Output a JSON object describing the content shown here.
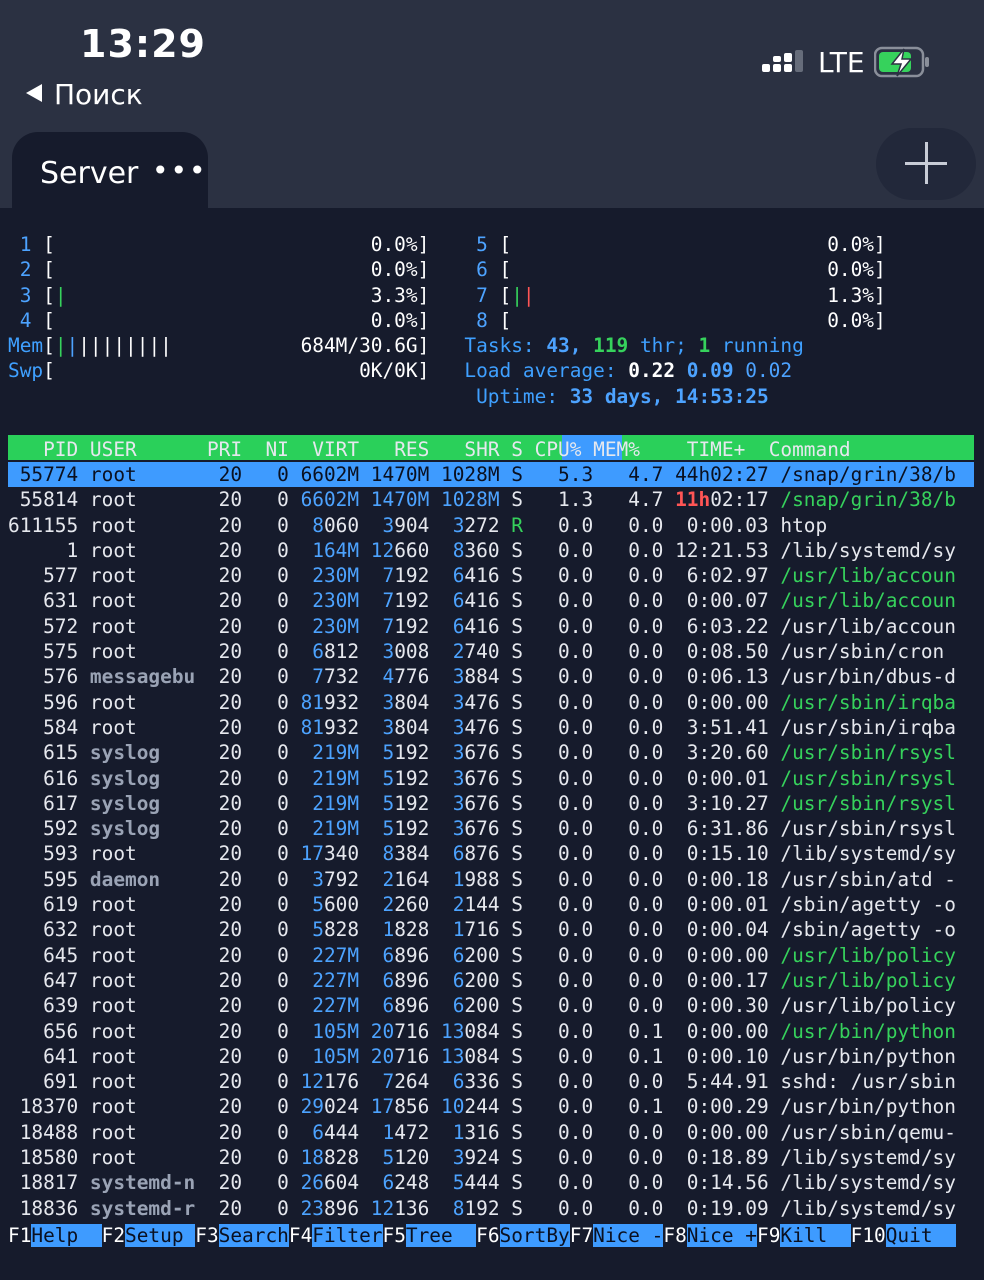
{
  "status_bar": {
    "time": "13:29",
    "back_label": "Поиск",
    "network": "LTE"
  },
  "tabs": [
    {
      "label": "Server"
    }
  ],
  "meters": {
    "cpus": [
      {
        "id": "1",
        "bar": "",
        "value": "0.0%"
      },
      {
        "id": "2",
        "bar": "",
        "value": "0.0%"
      },
      {
        "id": "3",
        "bar": "|",
        "value": "3.3%"
      },
      {
        "id": "4",
        "bar": "",
        "value": "0.0%"
      },
      {
        "id": "5",
        "bar": "",
        "value": "0.0%"
      },
      {
        "id": "6",
        "bar": "",
        "value": "0.0%"
      },
      {
        "id": "7",
        "bar": "||",
        "value": "1.3%"
      },
      {
        "id": "8",
        "bar": "",
        "value": "0.0%"
      }
    ],
    "mem_label": "Mem",
    "mem_bar": "||||||||||",
    "mem_value": "684M/30.6G",
    "swp_label": "Swp",
    "swp_value": "0K/0K",
    "tasks_label": "Tasks:",
    "tasks": "43,",
    "threads": "119",
    "thr_label": "thr;",
    "running": "1",
    "running_label": "running",
    "load_label": "Load average:",
    "load1": "0.22",
    "load5": "0.09",
    "load15": "0.02",
    "uptime_label": "Uptime:",
    "uptime": "33 days, 14:53:25"
  },
  "columns": [
    "PID",
    "USER",
    "PRI",
    "NI",
    "VIRT",
    "RES",
    "SHR",
    "S",
    "CPU%",
    "MEM%",
    "TIME+",
    "Command"
  ],
  "processes": [
    {
      "pid": "55774",
      "user": "root",
      "pri": "20",
      "ni": "0",
      "virt": "6602M",
      "res": "1470M",
      "shr": "1028M",
      "s": "S",
      "cpu": "5.3",
      "mem": "4.7",
      "time": "44h02:27",
      "cmd": "/snap/grin/38/b"
    },
    {
      "pid": "55814",
      "user": "root",
      "pri": "20",
      "ni": "0",
      "virt": "6602M",
      "res": "1470M",
      "shr": "1028M",
      "s": "S",
      "cpu": "1.3",
      "mem": "4.7",
      "time": "11h02:17",
      "cmd": "/snap/grin/38/b"
    },
    {
      "pid": "611155",
      "user": "root",
      "pri": "20",
      "ni": "0",
      "virt": "8060",
      "res": "3904",
      "shr": "3272",
      "s": "R",
      "cpu": "0.0",
      "mem": "0.0",
      "time": "0:00.03",
      "cmd": "htop"
    },
    {
      "pid": "1",
      "user": "root",
      "pri": "20",
      "ni": "0",
      "virt": "164M",
      "res": "12660",
      "shr": "8360",
      "s": "S",
      "cpu": "0.0",
      "mem": "0.0",
      "time": "12:21.53",
      "cmd": "/lib/systemd/sy"
    },
    {
      "pid": "577",
      "user": "root",
      "pri": "20",
      "ni": "0",
      "virt": "230M",
      "res": "7192",
      "shr": "6416",
      "s": "S",
      "cpu": "0.0",
      "mem": "0.0",
      "time": "6:02.97",
      "cmd": "/usr/lib/accoun"
    },
    {
      "pid": "631",
      "user": "root",
      "pri": "20",
      "ni": "0",
      "virt": "230M",
      "res": "7192",
      "shr": "6416",
      "s": "S",
      "cpu": "0.0",
      "mem": "0.0",
      "time": "0:00.07",
      "cmd": "/usr/lib/accoun"
    },
    {
      "pid": "572",
      "user": "root",
      "pri": "20",
      "ni": "0",
      "virt": "230M",
      "res": "7192",
      "shr": "6416",
      "s": "S",
      "cpu": "0.0",
      "mem": "0.0",
      "time": "6:03.22",
      "cmd": "/usr/lib/accoun"
    },
    {
      "pid": "575",
      "user": "root",
      "pri": "20",
      "ni": "0",
      "virt": "6812",
      "res": "3008",
      "shr": "2740",
      "s": "S",
      "cpu": "0.0",
      "mem": "0.0",
      "time": "0:08.50",
      "cmd": "/usr/sbin/cron"
    },
    {
      "pid": "576",
      "user": "messagebu",
      "pri": "20",
      "ni": "0",
      "virt": "7732",
      "res": "4776",
      "shr": "3884",
      "s": "S",
      "cpu": "0.0",
      "mem": "0.0",
      "time": "0:06.13",
      "cmd": "/usr/bin/dbus-d"
    },
    {
      "pid": "596",
      "user": "root",
      "pri": "20",
      "ni": "0",
      "virt": "81932",
      "res": "3804",
      "shr": "3476",
      "s": "S",
      "cpu": "0.0",
      "mem": "0.0",
      "time": "0:00.00",
      "cmd": "/usr/sbin/irqba"
    },
    {
      "pid": "584",
      "user": "root",
      "pri": "20",
      "ni": "0",
      "virt": "81932",
      "res": "3804",
      "shr": "3476",
      "s": "S",
      "cpu": "0.0",
      "mem": "0.0",
      "time": "3:51.41",
      "cmd": "/usr/sbin/irqba"
    },
    {
      "pid": "615",
      "user": "syslog",
      "pri": "20",
      "ni": "0",
      "virt": "219M",
      "res": "5192",
      "shr": "3676",
      "s": "S",
      "cpu": "0.0",
      "mem": "0.0",
      "time": "3:20.60",
      "cmd": "/usr/sbin/rsysl"
    },
    {
      "pid": "616",
      "user": "syslog",
      "pri": "20",
      "ni": "0",
      "virt": "219M",
      "res": "5192",
      "shr": "3676",
      "s": "S",
      "cpu": "0.0",
      "mem": "0.0",
      "time": "0:00.01",
      "cmd": "/usr/sbin/rsysl"
    },
    {
      "pid": "617",
      "user": "syslog",
      "pri": "20",
      "ni": "0",
      "virt": "219M",
      "res": "5192",
      "shr": "3676",
      "s": "S",
      "cpu": "0.0",
      "mem": "0.0",
      "time": "3:10.27",
      "cmd": "/usr/sbin/rsysl"
    },
    {
      "pid": "592",
      "user": "syslog",
      "pri": "20",
      "ni": "0",
      "virt": "219M",
      "res": "5192",
      "shr": "3676",
      "s": "S",
      "cpu": "0.0",
      "mem": "0.0",
      "time": "6:31.86",
      "cmd": "/usr/sbin/rsysl"
    },
    {
      "pid": "593",
      "user": "root",
      "pri": "20",
      "ni": "0",
      "virt": "17340",
      "res": "8384",
      "shr": "6876",
      "s": "S",
      "cpu": "0.0",
      "mem": "0.0",
      "time": "0:15.10",
      "cmd": "/lib/systemd/sy"
    },
    {
      "pid": "595",
      "user": "daemon",
      "pri": "20",
      "ni": "0",
      "virt": "3792",
      "res": "2164",
      "shr": "1988",
      "s": "S",
      "cpu": "0.0",
      "mem": "0.0",
      "time": "0:00.18",
      "cmd": "/usr/sbin/atd -"
    },
    {
      "pid": "619",
      "user": "root",
      "pri": "20",
      "ni": "0",
      "virt": "5600",
      "res": "2260",
      "shr": "2144",
      "s": "S",
      "cpu": "0.0",
      "mem": "0.0",
      "time": "0:00.01",
      "cmd": "/sbin/agetty -o"
    },
    {
      "pid": "632",
      "user": "root",
      "pri": "20",
      "ni": "0",
      "virt": "5828",
      "res": "1828",
      "shr": "1716",
      "s": "S",
      "cpu": "0.0",
      "mem": "0.0",
      "time": "0:00.04",
      "cmd": "/sbin/agetty -o"
    },
    {
      "pid": "645",
      "user": "root",
      "pri": "20",
      "ni": "0",
      "virt": "227M",
      "res": "6896",
      "shr": "6200",
      "s": "S",
      "cpu": "0.0",
      "mem": "0.0",
      "time": "0:00.00",
      "cmd": "/usr/lib/policy"
    },
    {
      "pid": "647",
      "user": "root",
      "pri": "20",
      "ni": "0",
      "virt": "227M",
      "res": "6896",
      "shr": "6200",
      "s": "S",
      "cpu": "0.0",
      "mem": "0.0",
      "time": "0:00.17",
      "cmd": "/usr/lib/policy"
    },
    {
      "pid": "639",
      "user": "root",
      "pri": "20",
      "ni": "0",
      "virt": "227M",
      "res": "6896",
      "shr": "6200",
      "s": "S",
      "cpu": "0.0",
      "mem": "0.0",
      "time": "0:00.30",
      "cmd": "/usr/lib/policy"
    },
    {
      "pid": "656",
      "user": "root",
      "pri": "20",
      "ni": "0",
      "virt": "105M",
      "res": "20716",
      "shr": "13084",
      "s": "S",
      "cpu": "0.0",
      "mem": "0.1",
      "time": "0:00.00",
      "cmd": "/usr/bin/python"
    },
    {
      "pid": "641",
      "user": "root",
      "pri": "20",
      "ni": "0",
      "virt": "105M",
      "res": "20716",
      "shr": "13084",
      "s": "S",
      "cpu": "0.0",
      "mem": "0.1",
      "time": "0:00.10",
      "cmd": "/usr/bin/python"
    },
    {
      "pid": "691",
      "user": "root",
      "pri": "20",
      "ni": "0",
      "virt": "12176",
      "res": "7264",
      "shr": "6336",
      "s": "S",
      "cpu": "0.0",
      "mem": "0.0",
      "time": "5:44.91",
      "cmd": "sshd: /usr/sbin"
    },
    {
      "pid": "18370",
      "user": "root",
      "pri": "20",
      "ni": "0",
      "virt": "29024",
      "res": "17856",
      "shr": "10244",
      "s": "S",
      "cpu": "0.0",
      "mem": "0.1",
      "time": "0:00.29",
      "cmd": "/usr/bin/python"
    },
    {
      "pid": "18488",
      "user": "root",
      "pri": "20",
      "ni": "0",
      "virt": "6444",
      "res": "1472",
      "shr": "1316",
      "s": "S",
      "cpu": "0.0",
      "mem": "0.0",
      "time": "0:00.00",
      "cmd": "/usr/sbin/qemu-"
    },
    {
      "pid": "18580",
      "user": "root",
      "pri": "20",
      "ni": "0",
      "virt": "18828",
      "res": "5120",
      "shr": "3924",
      "s": "S",
      "cpu": "0.0",
      "mem": "0.0",
      "time": "0:18.89",
      "cmd": "/lib/systemd/sy"
    },
    {
      "pid": "18817",
      "user": "systemd-n",
      "pri": "20",
      "ni": "0",
      "virt": "26604",
      "res": "6248",
      "shr": "5444",
      "s": "S",
      "cpu": "0.0",
      "mem": "0.0",
      "time": "0:14.56",
      "cmd": "/lib/systemd/sy"
    },
    {
      "pid": "18836",
      "user": "systemd-r",
      "pri": "20",
      "ni": "0",
      "virt": "23896",
      "res": "12136",
      "shr": "8192",
      "s": "S",
      "cpu": "0.0",
      "mem": "0.0",
      "time": "0:19.09",
      "cmd": "/lib/systemd/sy"
    }
  ],
  "function_keys": [
    {
      "key": "F1",
      "label": "Help  "
    },
    {
      "key": "F2",
      "label": "Setup "
    },
    {
      "key": "F3",
      "label": "Search"
    },
    {
      "key": "F4",
      "label": "Filter"
    },
    {
      "key": "F5",
      "label": "Tree  "
    },
    {
      "key": "F6",
      "label": "SortBy"
    },
    {
      "key": "F7",
      "label": "Nice -"
    },
    {
      "key": "F8",
      "label": "Nice +"
    },
    {
      "key": "F9",
      "label": "Kill  "
    },
    {
      "key": "F10",
      "label": "Quit  "
    }
  ],
  "colors": {
    "header_green": "#2ad05a",
    "selection_blue": "#3e9bff",
    "background": "#161b2c"
  }
}
